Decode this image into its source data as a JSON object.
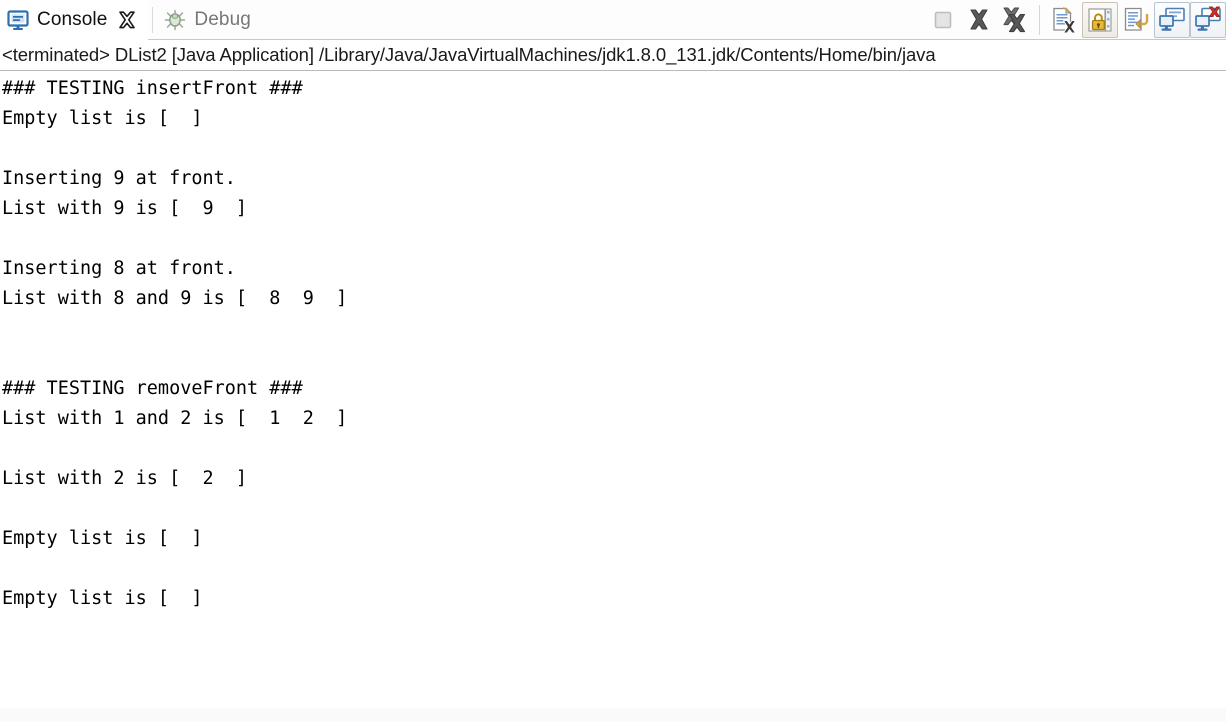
{
  "window": {
    "title": "Console"
  },
  "tabs": [
    {
      "id": "console",
      "label": "Console",
      "icon": "console-monitor-icon",
      "active": true,
      "closable": true
    },
    {
      "id": "debug",
      "label": "Debug",
      "icon": "bug-icon",
      "active": false,
      "closable": false
    }
  ],
  "toolbar": {
    "buttons": [
      {
        "id": "terminate",
        "label": "Terminate",
        "icon": "stop-square-icon",
        "enabled": false,
        "framed": false
      },
      {
        "id": "remove-launch",
        "label": "Remove Launch",
        "icon": "remove-x-icon",
        "enabled": true,
        "framed": false
      },
      {
        "id": "remove-all-terminated",
        "label": "Remove All Terminated Launches",
        "icon": "remove-all-x-icon",
        "enabled": true,
        "framed": false
      },
      {
        "id": "clear-console",
        "label": "Clear Console",
        "icon": "clear-console-icon",
        "enabled": true,
        "framed": false
      },
      {
        "id": "scroll-lock",
        "label": "Scroll Lock",
        "icon": "lock-icon",
        "enabled": true,
        "framed": true
      },
      {
        "id": "word-wrap",
        "label": "Word Wrap",
        "icon": "word-wrap-icon",
        "enabled": true,
        "framed": false
      },
      {
        "id": "pin-console",
        "label": "Pin Console",
        "icon": "pin-console-icon",
        "enabled": true,
        "framed": true
      },
      {
        "id": "display-selected-console",
        "label": "Display Selected Console",
        "icon": "display-console-icon",
        "enabled": true,
        "framed": true
      }
    ]
  },
  "launch": {
    "status": "<terminated>",
    "name": "DList2",
    "type": "[Java Application]",
    "path": "/Library/Java/JavaVirtualMachines/jdk1.8.0_131.jdk/Contents/Home/bin/java",
    "full_text": "<terminated> DList2 [Java Application] /Library/Java/JavaVirtualMachines/jdk1.8.0_131.jdk/Contents/Home/bin/java"
  },
  "console": {
    "lines": [
      "### TESTING insertFront ###",
      "Empty list is [  ]",
      "",
      "Inserting 9 at front.",
      "List with 9 is [  9  ]",
      "",
      "Inserting 8 at front.",
      "List with 8 and 9 is [  8  9  ]",
      "",
      "",
      "### TESTING removeFront ###",
      "List with 1 and 2 is [  1  2  ]",
      "",
      "List with 2 is [  2  ]",
      "",
      "Empty list is [  ]",
      "",
      "Empty list is [  ]"
    ]
  },
  "colors": {
    "console_bg": "#ffffff",
    "text": "#000000",
    "tab_active_text": "#111111",
    "tab_inactive_text": "#777777",
    "separator": "#c8c8c8",
    "icon_blue": "#2f6fae",
    "icon_gray": "#565656",
    "lock_gold": "#d9a521",
    "error_red": "#d0342c"
  }
}
